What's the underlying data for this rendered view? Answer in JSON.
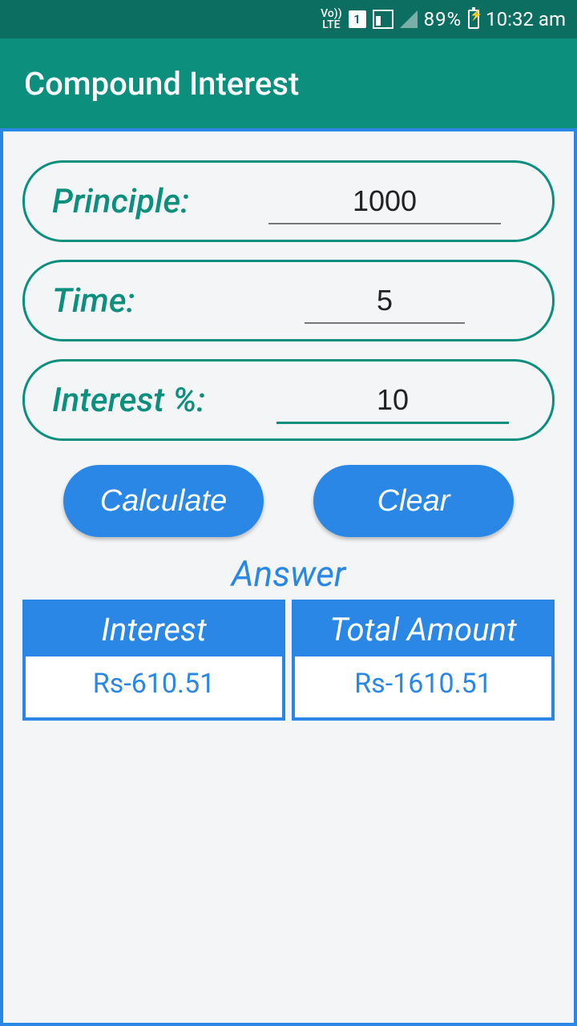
{
  "status": {
    "lte": "Vo))\nLTE",
    "sim": "1",
    "battery_pct": "89%",
    "time": "10:32 am"
  },
  "header": {
    "title": "Compound Interest"
  },
  "fields": {
    "principle": {
      "label": "Principle:",
      "value": "1000"
    },
    "time": {
      "label": "Time:",
      "value": "5"
    },
    "rate": {
      "label": "Interest %:",
      "value": "10"
    }
  },
  "buttons": {
    "calculate": "Calculate",
    "clear": "Clear"
  },
  "answer": {
    "title": "Answer",
    "interest": {
      "label": "Interest",
      "value": "Rs-610.51"
    },
    "total": {
      "label": "Total Amount",
      "value": "Rs-1610.51"
    }
  }
}
